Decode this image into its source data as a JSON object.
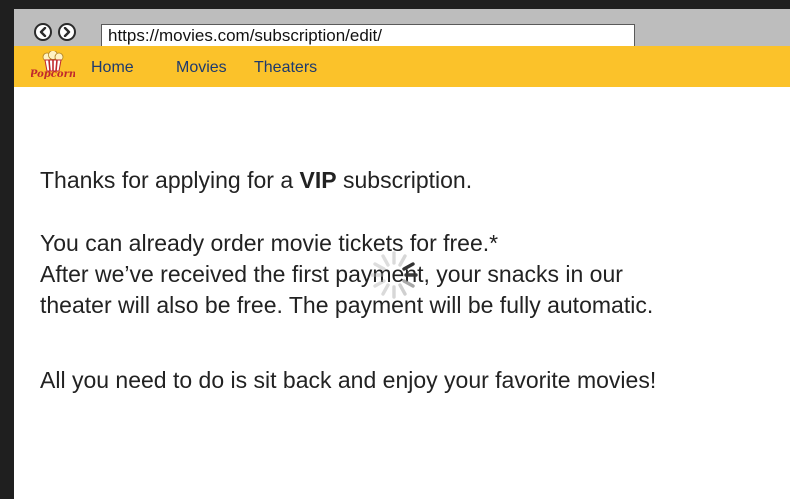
{
  "browser": {
    "url": "https://movies.com/subscription/edit/",
    "back_icon": "chevron-left-icon",
    "forward_icon": "chevron-right-icon"
  },
  "navbar": {
    "logo_text": "Popcorn",
    "links": [
      "Home",
      "Movies",
      "Theaters"
    ],
    "background": "#fbc22a",
    "link_color": "#1e3a6e"
  },
  "content": {
    "line1_before": "Thanks for applying for a ",
    "line1_bold": "VIP",
    "line1_after": " subscription.",
    "line2": "You can already order movie tickets for free.*",
    "line3": "After we’ve received the first payment, your snacks in our",
    "line4": "theater will also be free. The payment will be fully automatic.",
    "line5": "All you need to do is sit back and enjoy your favorite movies!"
  },
  "overlay": {
    "spinner_icon": "loading-spinner-icon"
  }
}
